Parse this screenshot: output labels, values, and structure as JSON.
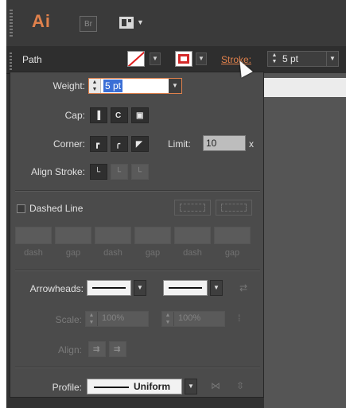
{
  "app": {
    "logo": "Ai",
    "bridge_logo": "Br",
    "layout_icon": "workspace-layout-icon"
  },
  "control_bar": {
    "selection_label": "Path",
    "stroke_label": "Stroke:",
    "stroke_value": "5 pt",
    "fill_color": "#ffffff",
    "stroke_color": "#d42a2a"
  },
  "stroke_panel": {
    "weight_label": "Weight:",
    "weight_value": "5 pt",
    "cap_label": "Cap:",
    "corner_label": "Corner:",
    "limit_label": "Limit:",
    "limit_value": "10",
    "limit_unit": "x",
    "align_label": "Align Stroke:",
    "dashed_label": "Dashed Line",
    "dashed_checked": false,
    "dash_fields": [
      "dash",
      "gap",
      "dash",
      "gap",
      "dash",
      "gap"
    ],
    "arrowheads_label": "Arrowheads:",
    "scale_label": "Scale:",
    "scale_start": "100%",
    "scale_end": "100%",
    "align_arrow_label": "Align:",
    "profile_label": "Profile:",
    "profile_value": "Uniform"
  }
}
